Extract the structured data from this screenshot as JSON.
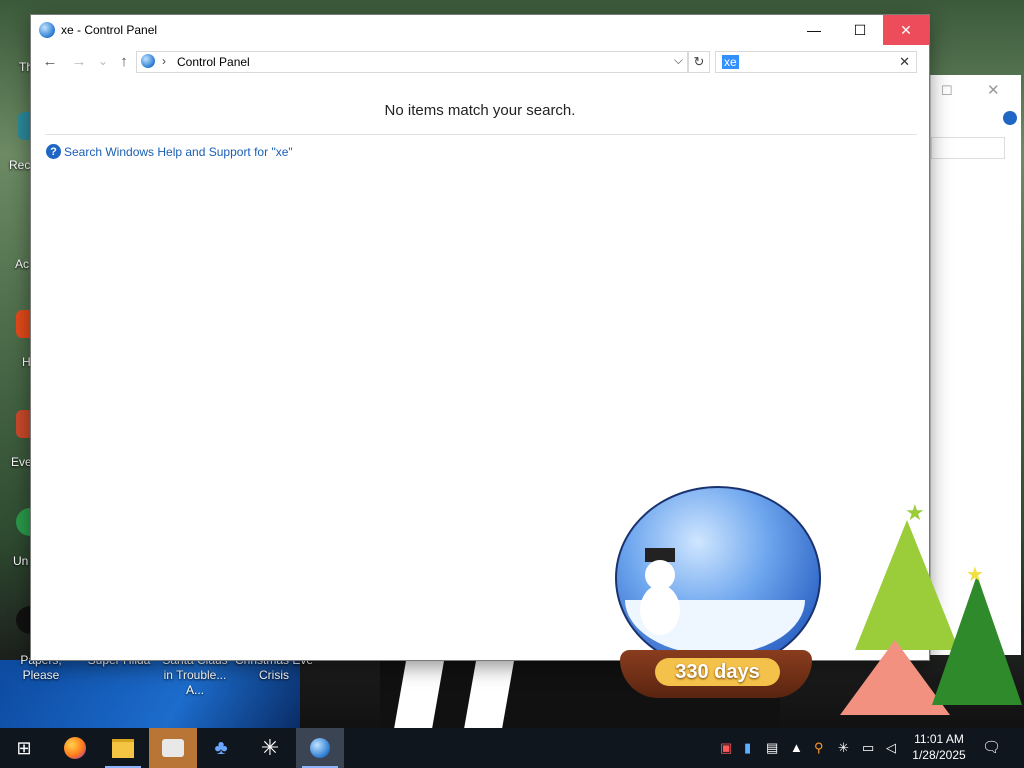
{
  "window": {
    "title": "xe - Control Panel",
    "minimize_glyph": "—",
    "maximize_glyph": "☐",
    "close_glyph": "✕"
  },
  "navbar": {
    "back_glyph": "←",
    "forward_glyph": "→",
    "recent_glyph": "⌄",
    "up_glyph": "↑",
    "breadcrumb_sep": "›",
    "address": "Control Panel",
    "address_dropdown_glyph": "⌵",
    "refresh_glyph": "↻",
    "search_value": "xe",
    "search_clear_glyph": "✕"
  },
  "content": {
    "empty_message": "No items match your search.",
    "help_link": "Search Windows Help and Support for \"xe\"",
    "help_icon_glyph": "?"
  },
  "desktop": {
    "shortcuts": [
      {
        "label": "Papers, Please"
      },
      {
        "label": "Super Hilda"
      },
      {
        "label": "Santa Claus in Trouble... A..."
      },
      {
        "label": "Christmas Eve Crisis"
      }
    ],
    "partial_labels": [
      "Th",
      "Rec",
      "Ac",
      "H",
      "Eve",
      "Un"
    ]
  },
  "widget": {
    "countdown": "330 days"
  },
  "taskbar": {
    "start_glyph": "⊞",
    "apps": [
      {
        "name": "firefox",
        "glyph": "●",
        "state": "normal"
      },
      {
        "name": "file-explorer",
        "glyph": "▬",
        "state": "normal"
      },
      {
        "name": "scanner-app",
        "glyph": "▤",
        "state": "active"
      },
      {
        "name": "people-app",
        "glyph": "♣",
        "state": "normal"
      },
      {
        "name": "snowflake-app",
        "glyph": "✳",
        "state": "normal"
      },
      {
        "name": "control-panel",
        "glyph": "◉",
        "state": "open"
      }
    ],
    "time": "11:01 AM",
    "date": "1/28/2025",
    "notification_glyph": "🗨"
  },
  "colors": {
    "close_button": "#e81123",
    "link": "#1a5fb4",
    "taskbar": "#10161e",
    "active_app": "#b87536"
  }
}
